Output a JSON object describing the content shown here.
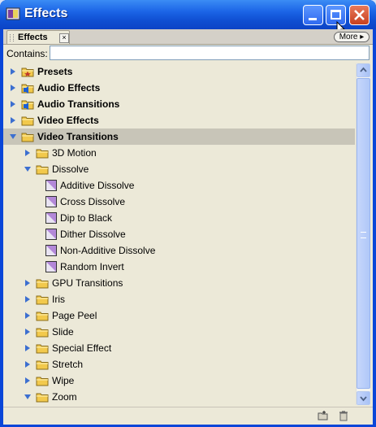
{
  "window": {
    "title": "Effects"
  },
  "panel": {
    "tab_label": "Effects",
    "tab_close_glyph": "×",
    "more_button": "More ▸"
  },
  "search": {
    "label": "Contains:",
    "value": "",
    "placeholder": ""
  },
  "tree": {
    "rows": [
      {
        "label": "Presets",
        "level": 0,
        "expanded": false,
        "type": "preset-bin",
        "bold": true,
        "selected": false
      },
      {
        "label": "Audio Effects",
        "level": 0,
        "expanded": false,
        "type": "audio-bin",
        "bold": true,
        "selected": false
      },
      {
        "label": "Audio Transitions",
        "level": 0,
        "expanded": false,
        "type": "audio-bin",
        "bold": true,
        "selected": false
      },
      {
        "label": "Video Effects",
        "level": 0,
        "expanded": false,
        "type": "folder",
        "bold": true,
        "selected": false
      },
      {
        "label": "Video Transitions",
        "level": 0,
        "expanded": true,
        "type": "folder",
        "bold": true,
        "selected": true
      },
      {
        "label": "3D Motion",
        "level": 1,
        "expanded": false,
        "type": "folder",
        "bold": false,
        "selected": false
      },
      {
        "label": "Dissolve",
        "level": 1,
        "expanded": true,
        "type": "folder",
        "bold": false,
        "selected": false
      },
      {
        "label": "Additive Dissolve",
        "level": 2,
        "type": "effect",
        "bold": false,
        "selected": false
      },
      {
        "label": "Cross Dissolve",
        "level": 2,
        "type": "effect",
        "bold": false,
        "selected": false
      },
      {
        "label": "Dip to Black",
        "level": 2,
        "type": "effect",
        "bold": false,
        "selected": false
      },
      {
        "label": "Dither Dissolve",
        "level": 2,
        "type": "effect",
        "bold": false,
        "selected": false
      },
      {
        "label": "Non-Additive Dissolve",
        "level": 2,
        "type": "effect",
        "bold": false,
        "selected": false
      },
      {
        "label": "Random Invert",
        "level": 2,
        "type": "effect",
        "bold": false,
        "selected": false
      },
      {
        "label": "GPU Transitions",
        "level": 1,
        "expanded": false,
        "type": "folder",
        "bold": false,
        "selected": false
      },
      {
        "label": "Iris",
        "level": 1,
        "expanded": false,
        "type": "folder",
        "bold": false,
        "selected": false
      },
      {
        "label": "Page Peel",
        "level": 1,
        "expanded": false,
        "type": "folder",
        "bold": false,
        "selected": false
      },
      {
        "label": "Slide",
        "level": 1,
        "expanded": false,
        "type": "folder",
        "bold": false,
        "selected": false
      },
      {
        "label": "Special Effect",
        "level": 1,
        "expanded": false,
        "type": "folder",
        "bold": false,
        "selected": false
      },
      {
        "label": "Stretch",
        "level": 1,
        "expanded": false,
        "type": "folder",
        "bold": false,
        "selected": false
      },
      {
        "label": "Wipe",
        "level": 1,
        "expanded": false,
        "type": "folder",
        "bold": false,
        "selected": false
      },
      {
        "label": "Zoom",
        "level": 1,
        "expanded": true,
        "type": "folder",
        "bold": false,
        "selected": false
      }
    ]
  },
  "icons": {
    "app": "effects-app-icon",
    "folder": "folder-icon",
    "effect": "transition-effect-icon",
    "new_bin": "new-custom-bin-icon",
    "delete": "trash-icon"
  },
  "colors": {
    "titlebar": "#0f4fd2",
    "panel_bg": "#ece9d8",
    "selected_row": "#c8c5b8",
    "folder": "#f2c94c",
    "arrow": "#3c6fd0",
    "effect": "#b388d8",
    "close": "#c7401f"
  }
}
